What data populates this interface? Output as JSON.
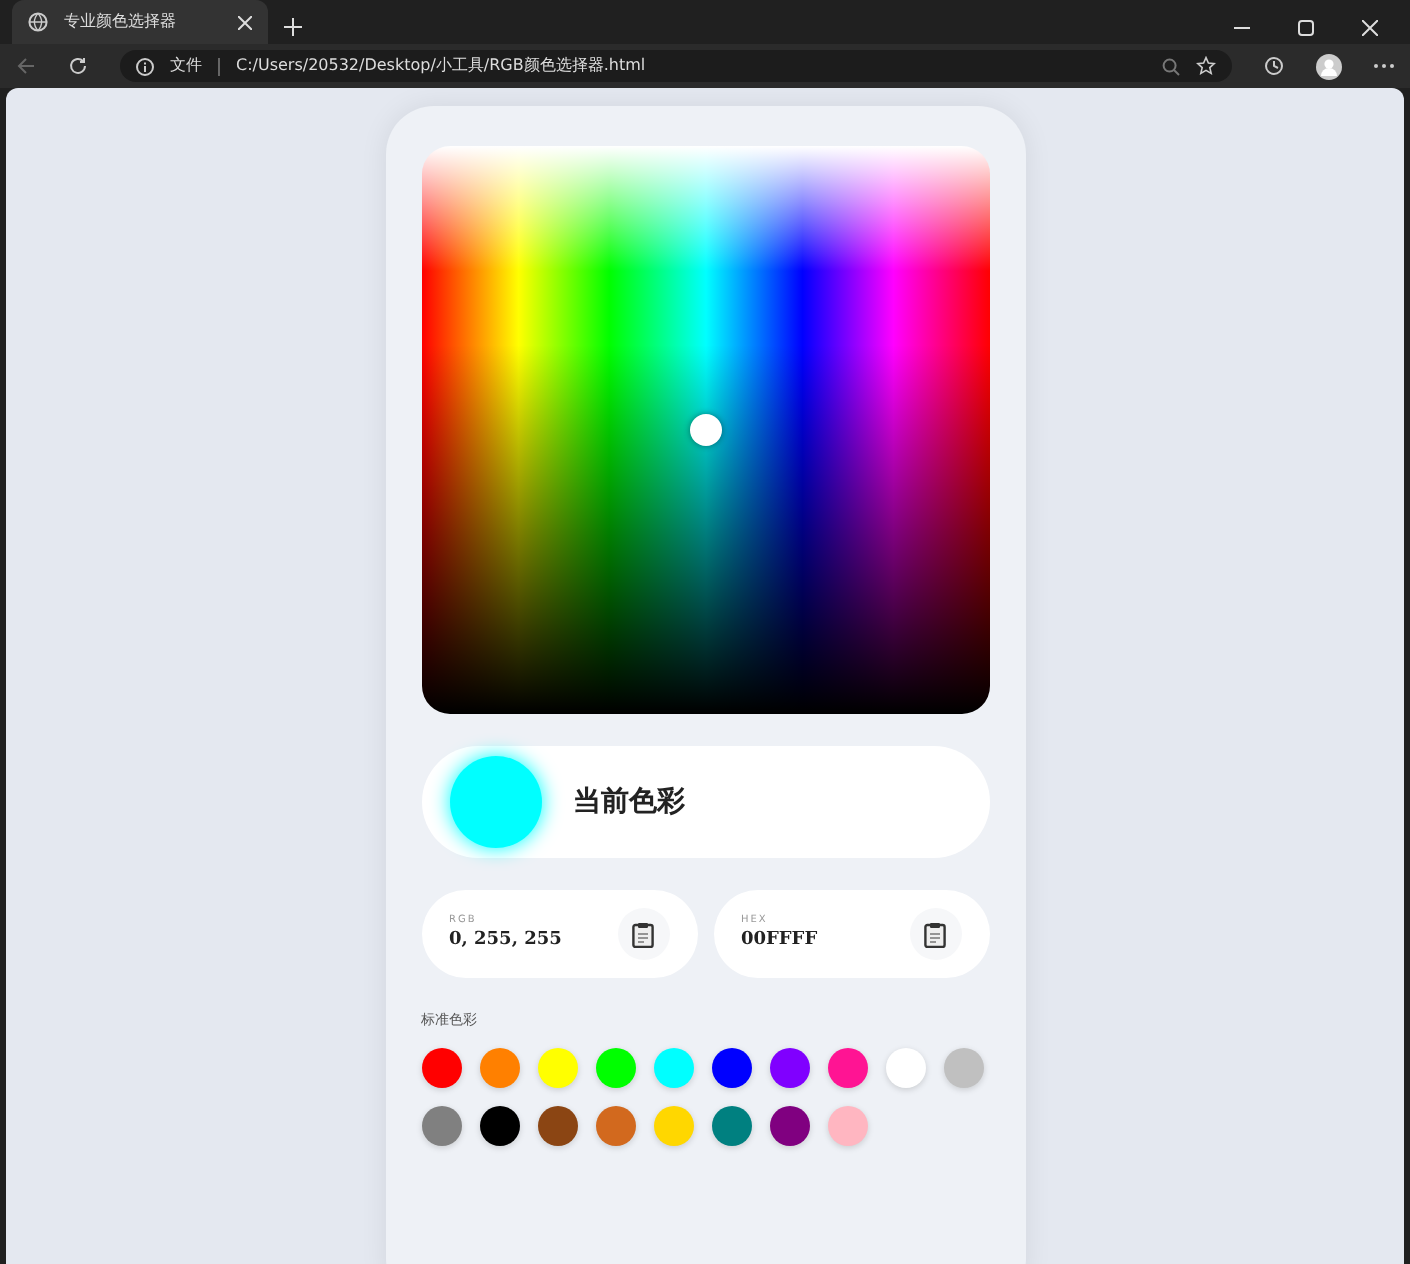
{
  "browser": {
    "tab_title": "专业颜色选择器",
    "url_label": "文件",
    "url": "C:/Users/20532/Desktop/小工具/RGB颜色选择器.html"
  },
  "current": {
    "label": "当前色彩",
    "color": "#00ffff"
  },
  "values": [
    {
      "label": "RGB",
      "value": "0, 255, 255"
    },
    {
      "label": "HEX",
      "value": "00FFFF"
    }
  ],
  "swatches_label": "标准色彩",
  "swatches": [
    {
      "color": "#ff0000"
    },
    {
      "color": "#ff8000"
    },
    {
      "color": "#ffff00"
    },
    {
      "color": "#00ff00"
    },
    {
      "color": "#00ffff"
    },
    {
      "color": "#0000ff"
    },
    {
      "color": "#8000ff"
    },
    {
      "color": "#ff1493"
    },
    {
      "color": "#ffffff"
    },
    {
      "color": "#c0c0c0"
    },
    {
      "color": "#808080"
    },
    {
      "color": "#000000"
    },
    {
      "color": "#8b4513"
    },
    {
      "color": "#d2691e"
    },
    {
      "color": "#ffd700"
    },
    {
      "color": "#008080"
    },
    {
      "color": "#800080"
    },
    {
      "color": "#ffb6c1"
    }
  ]
}
